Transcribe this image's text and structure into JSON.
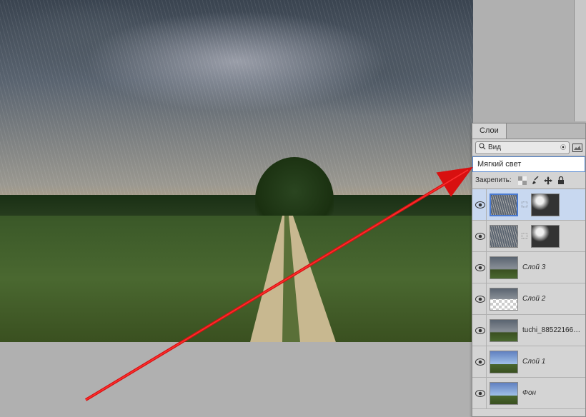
{
  "panel": {
    "tab_label": "Слои",
    "filter_label": "Вид",
    "blend_mode": "Мягкий свет",
    "lock_label": "Закрепить:",
    "layers": [
      {
        "name": "",
        "type": "rain-mask",
        "selected": true,
        "has_mask": true
      },
      {
        "name": "",
        "type": "rain-mask2",
        "selected": false,
        "has_mask": true
      },
      {
        "name": "Слой 3",
        "type": "storm",
        "selected": false,
        "has_mask": false
      },
      {
        "name": "Слой 2",
        "type": "checker",
        "selected": false,
        "has_mask": false
      },
      {
        "name": "tuchi_88522166…",
        "type": "storm",
        "selected": false,
        "has_mask": false
      },
      {
        "name": "Слой 1",
        "type": "clear",
        "selected": false,
        "has_mask": false
      },
      {
        "name": "Фон",
        "type": "clear",
        "selected": false,
        "has_mask": false
      }
    ]
  }
}
